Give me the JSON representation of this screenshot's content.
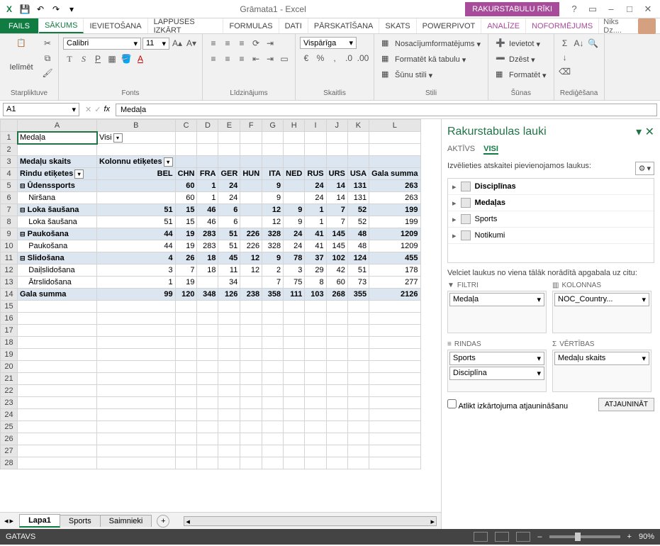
{
  "titlebar": {
    "title": "Grāmata1 - Excel",
    "context_tab": "RAKURSTABULU RĪKI"
  },
  "tabs": {
    "list": [
      "FAILS",
      "SĀKUMS",
      "IEVIETOŠANA",
      "LAPPUSES IZKĀRT",
      "FORMULAS",
      "DATI",
      "PĀRSKATĪŠANA",
      "SKATS",
      "POWERPIVOT",
      "ANALĪZE",
      "NOFORMĒJUMS"
    ],
    "user": "Niks Dz...."
  },
  "ribbon": {
    "clipboard": {
      "paste": "Ielīmēt",
      "label": "Starpliktuve"
    },
    "font": {
      "name": "Calibri",
      "size": "11",
      "label": "Fonts"
    },
    "align": {
      "label": "Līdzinājums"
    },
    "number": {
      "format": "Vispārīga",
      "label": "Skaitlis"
    },
    "styles": {
      "cond": "Nosacījumformatējums",
      "table": "Formatēt kā tabulu",
      "cell": "Šūnu stili",
      "label": "Stili"
    },
    "cells": {
      "insert": "Ievietot",
      "delete": "Dzēst",
      "format": "Formatēt",
      "label": "Šūnas"
    },
    "editing": {
      "label": "Rediģēšana"
    }
  },
  "formula": {
    "cell": "A1",
    "value": "Medaļa"
  },
  "grid": {
    "cols": [
      "A",
      "B",
      "C",
      "D",
      "E",
      "F",
      "G",
      "H",
      "I",
      "J",
      "K",
      "L"
    ],
    "a1": "Medaļa",
    "b1": "Visi",
    "a3": "Medaļu skaits",
    "b3": "Kolonnu etiķetes",
    "a4": "Rindu etiķetes",
    "headers": [
      "BEL",
      "CHN",
      "FRA",
      "GER",
      "HUN",
      "ITA",
      "NED",
      "RUS",
      "URS",
      "USA",
      "Gala summa"
    ],
    "rows": [
      {
        "label": "Ūdenssports",
        "vals": [
          "",
          "60",
          "1",
          "24",
          "",
          "9",
          "",
          "24",
          "14",
          "131",
          "263"
        ],
        "bold": true,
        "expand": true
      },
      {
        "label": "Niršana",
        "vals": [
          "",
          "60",
          "1",
          "24",
          "",
          "9",
          "",
          "24",
          "14",
          "131",
          "263"
        ],
        "indent": true
      },
      {
        "label": "Loka šaušana",
        "vals": [
          "51",
          "15",
          "46",
          "6",
          "",
          "12",
          "9",
          "1",
          "7",
          "52",
          "199"
        ],
        "bold": true,
        "expand": true
      },
      {
        "label": "Loka šaušana",
        "vals": [
          "51",
          "15",
          "46",
          "6",
          "",
          "12",
          "9",
          "1",
          "7",
          "52",
          "199"
        ],
        "indent": true
      },
      {
        "label": "Paukošana",
        "vals": [
          "44",
          "19",
          "283",
          "51",
          "226",
          "328",
          "24",
          "41",
          "145",
          "48",
          "1209"
        ],
        "bold": true,
        "expand": true
      },
      {
        "label": "Paukošana",
        "vals": [
          "44",
          "19",
          "283",
          "51",
          "226",
          "328",
          "24",
          "41",
          "145",
          "48",
          "1209"
        ],
        "indent": true
      },
      {
        "label": "Slidošana",
        "vals": [
          "4",
          "26",
          "18",
          "45",
          "12",
          "9",
          "78",
          "37",
          "102",
          "124",
          "455"
        ],
        "bold": true,
        "expand": true
      },
      {
        "label": "Daiļslidošana",
        "vals": [
          "3",
          "7",
          "18",
          "11",
          "12",
          "2",
          "3",
          "29",
          "42",
          "51",
          "178"
        ],
        "indent": true
      },
      {
        "label": "Ātrslidošana",
        "vals": [
          "1",
          "19",
          "",
          "34",
          "",
          "7",
          "75",
          "8",
          "60",
          "73",
          "277"
        ],
        "indent": true
      }
    ],
    "grand": {
      "label": "Gala summa",
      "vals": [
        "99",
        "120",
        "348",
        "126",
        "238",
        "358",
        "111",
        "103",
        "268",
        "355",
        "2126"
      ]
    }
  },
  "sheets": {
    "tabs": [
      "Lapa1",
      "Sports",
      "Saimnieki"
    ]
  },
  "taskpane": {
    "title": "Rakurstabulas lauki",
    "tabs": [
      "AKTĪVS",
      "VISI"
    ],
    "choose": "Izvēlieties atskaitei pievienojamos laukus:",
    "fields": [
      "Disciplīnas",
      "Medaļas",
      "Sports",
      "Notikumi"
    ],
    "drag": "Velciet laukus no viena tālāk norādītā apgabala uz citu:",
    "zones": {
      "filters": {
        "h": "FILTRI",
        "items": [
          "Medaļa"
        ]
      },
      "columns": {
        "h": "KOLONNAS",
        "items": [
          "NOC_Country..."
        ]
      },
      "rows": {
        "h": "RINDAS",
        "items": [
          "Sports",
          "Disciplīna"
        ]
      },
      "values": {
        "h": "VĒRTĪBAS",
        "items": [
          "Medaļu skaits"
        ]
      }
    },
    "defer": "Atlikt izkārtojuma atjaunināšanu",
    "update": "ATJAUNINĀT"
  },
  "status": {
    "ready": "GATAVS",
    "zoom": "90%"
  }
}
